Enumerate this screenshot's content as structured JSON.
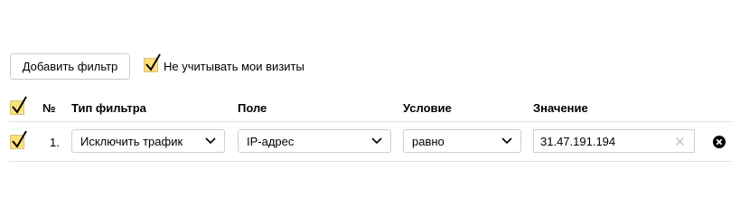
{
  "toolbar": {
    "add_filter_label": "Добавить фильтр",
    "ignore_visits_label": "Не учитывать мои визиты",
    "ignore_visits_checked": true
  },
  "table": {
    "headers": {
      "number": "№",
      "filter_type": "Тип фильтра",
      "field": "Поле",
      "condition": "Условие",
      "value": "Значение"
    },
    "rows": [
      {
        "checked": true,
        "number": "1.",
        "filter_type": "Исключить трафик",
        "field": "IP-адрес",
        "condition": "равно",
        "value": "31.47.191.194"
      }
    ]
  },
  "colors": {
    "checkbox_fill": "#fce178",
    "separator": "#e3e3e3",
    "border": "#cfcfcf"
  }
}
